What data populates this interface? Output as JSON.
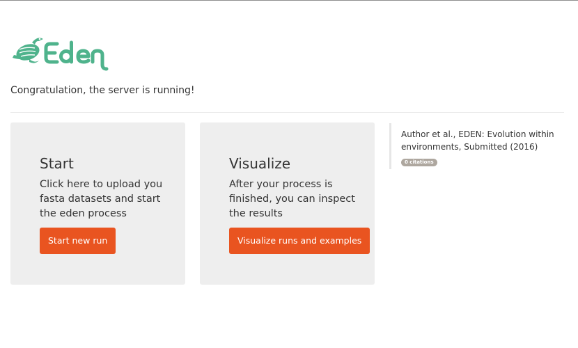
{
  "brand": {
    "logo_alt": "Eden",
    "logo_color": "#4fb38c"
  },
  "status_message": "Congratulation, the server is running!",
  "cards": [
    {
      "title": "Start",
      "text": "Click here to upload you fasta datasets and start the eden process",
      "button_label": "Start new run"
    },
    {
      "title": "Visualize",
      "text": "After your process is finished, you can inspect the results",
      "button_label": "Visualize runs and examples"
    }
  ],
  "citation": {
    "text": "Author et al., EDEN: Evolution within environments, Submitted (2016)",
    "badge": "0 citations"
  },
  "colors": {
    "accent": "#e95420",
    "card_bg": "#eeeeee",
    "badge_bg": "#aea79f"
  }
}
